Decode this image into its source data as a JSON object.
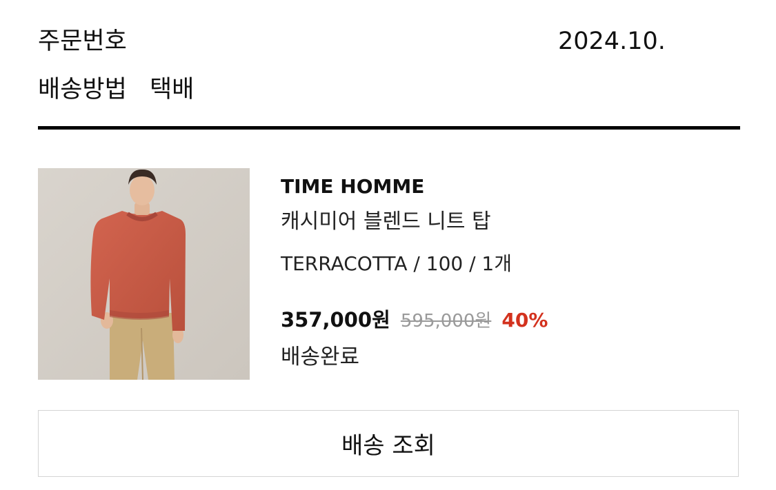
{
  "order": {
    "number_label": "주문번호",
    "date": "2024.10.",
    "shipping_method_label": "배송방법",
    "shipping_method_value": "택배"
  },
  "product": {
    "image_icon": "product-photo",
    "brand": "TIME HOMME",
    "name": "캐시미어 블렌드 니트 탑",
    "option": "TERRACOTTA / 100 / 1개",
    "sale_price": "357,000원",
    "original_price": "595,000원",
    "discount_rate": "40%",
    "status": "배송완료"
  },
  "actions": {
    "track_label": "배송 조회"
  },
  "colors": {
    "divider": "#000000",
    "discount": "#d3321e",
    "original_price": "#9a9a9a",
    "button_border": "#d4d4d4"
  }
}
